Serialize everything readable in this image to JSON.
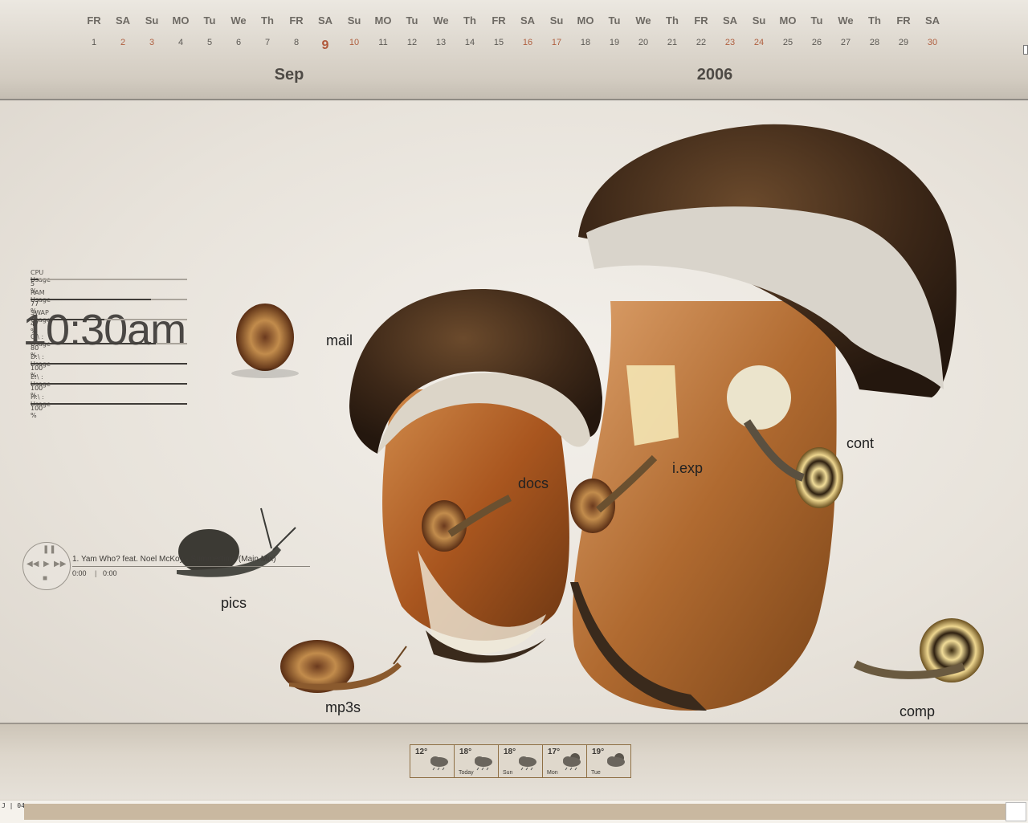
{
  "calendar": {
    "days": [
      {
        "d": "FR",
        "n": "1",
        "we": false
      },
      {
        "d": "SA",
        "n": "2",
        "we": true
      },
      {
        "d": "Su",
        "n": "3",
        "we": true
      },
      {
        "d": "MO",
        "n": "4",
        "we": false
      },
      {
        "d": "Tu",
        "n": "5",
        "we": false
      },
      {
        "d": "We",
        "n": "6",
        "we": false
      },
      {
        "d": "Th",
        "n": "7",
        "we": false
      },
      {
        "d": "FR",
        "n": "8",
        "we": false
      },
      {
        "d": "SA",
        "n": "9",
        "we": true,
        "today": true
      },
      {
        "d": "Su",
        "n": "10",
        "we": true
      },
      {
        "d": "MO",
        "n": "11",
        "we": false
      },
      {
        "d": "Tu",
        "n": "12",
        "we": false
      },
      {
        "d": "We",
        "n": "13",
        "we": false
      },
      {
        "d": "Th",
        "n": "14",
        "we": false
      },
      {
        "d": "FR",
        "n": "15",
        "we": false
      },
      {
        "d": "SA",
        "n": "16",
        "we": true
      },
      {
        "d": "Su",
        "n": "17",
        "we": true
      },
      {
        "d": "MO",
        "n": "18",
        "we": false
      },
      {
        "d": "Tu",
        "n": "19",
        "we": false
      },
      {
        "d": "We",
        "n": "20",
        "we": false
      },
      {
        "d": "Th",
        "n": "21",
        "we": false
      },
      {
        "d": "FR",
        "n": "22",
        "we": false
      },
      {
        "d": "SA",
        "n": "23",
        "we": true
      },
      {
        "d": "Su",
        "n": "24",
        "we": true
      },
      {
        "d": "MO",
        "n": "25",
        "we": false
      },
      {
        "d": "Tu",
        "n": "26",
        "we": false
      },
      {
        "d": "We",
        "n": "27",
        "we": false
      },
      {
        "d": "Th",
        "n": "28",
        "we": false
      },
      {
        "d": "FR",
        "n": "29",
        "we": false
      },
      {
        "d": "SA",
        "n": "30",
        "we": true
      }
    ],
    "month": "Sep",
    "year": "2006"
  },
  "clock": "10:30am",
  "stats": [
    {
      "label": "CPU Usage",
      "value": "5 %",
      "fraction": 0.05
    },
    {
      "label": "RAM Usage",
      "value": "77 %",
      "fraction": 0.77
    },
    {
      "label": "SWAP Usage",
      "value": "47 %",
      "fraction": 0.47
    },
    {
      "label": "C:\\ : Usage",
      "value": "80 %",
      "fraction": 0.8
    },
    {
      "label": "D:\\ : Usage",
      "value": "100 %",
      "fraction": 1.0
    },
    {
      "label": "E:\\ : Usage",
      "value": "100 %",
      "fraction": 1.0
    },
    {
      "label": "H:\\ : Usage",
      "value": "100 %",
      "fraction": 1.0
    }
  ],
  "player": {
    "track": "1. Yam Who? feat. Noel McKoy - Summertime (Main Mix)",
    "time_current": "0:00",
    "time_sep": "|",
    "time_total": "0:00"
  },
  "desktop_icons": {
    "mail": "mail",
    "pics": "pics",
    "mp3s": "mp3s",
    "docs": "docs",
    "iexp": "i.exp",
    "cont": "cont",
    "comp": "comp"
  },
  "weather": [
    {
      "temp": "12°",
      "day": "",
      "icon": "rain-cloud-icon"
    },
    {
      "temp": "18°",
      "day": "Today",
      "icon": "rain-cloud-icon"
    },
    {
      "temp": "18°",
      "day": "Sun",
      "icon": "rain-cloud-icon"
    },
    {
      "temp": "17°",
      "day": "Mon",
      "icon": "sun-rain-cloud-icon"
    },
    {
      "temp": "19°",
      "day": "Tue",
      "icon": "sun-cloud-icon"
    }
  ],
  "taskbar": {
    "tag": "J | 04"
  },
  "colors": {
    "accent": "#b0583a",
    "text": "#4a4744",
    "bar": "#3f3c38"
  }
}
